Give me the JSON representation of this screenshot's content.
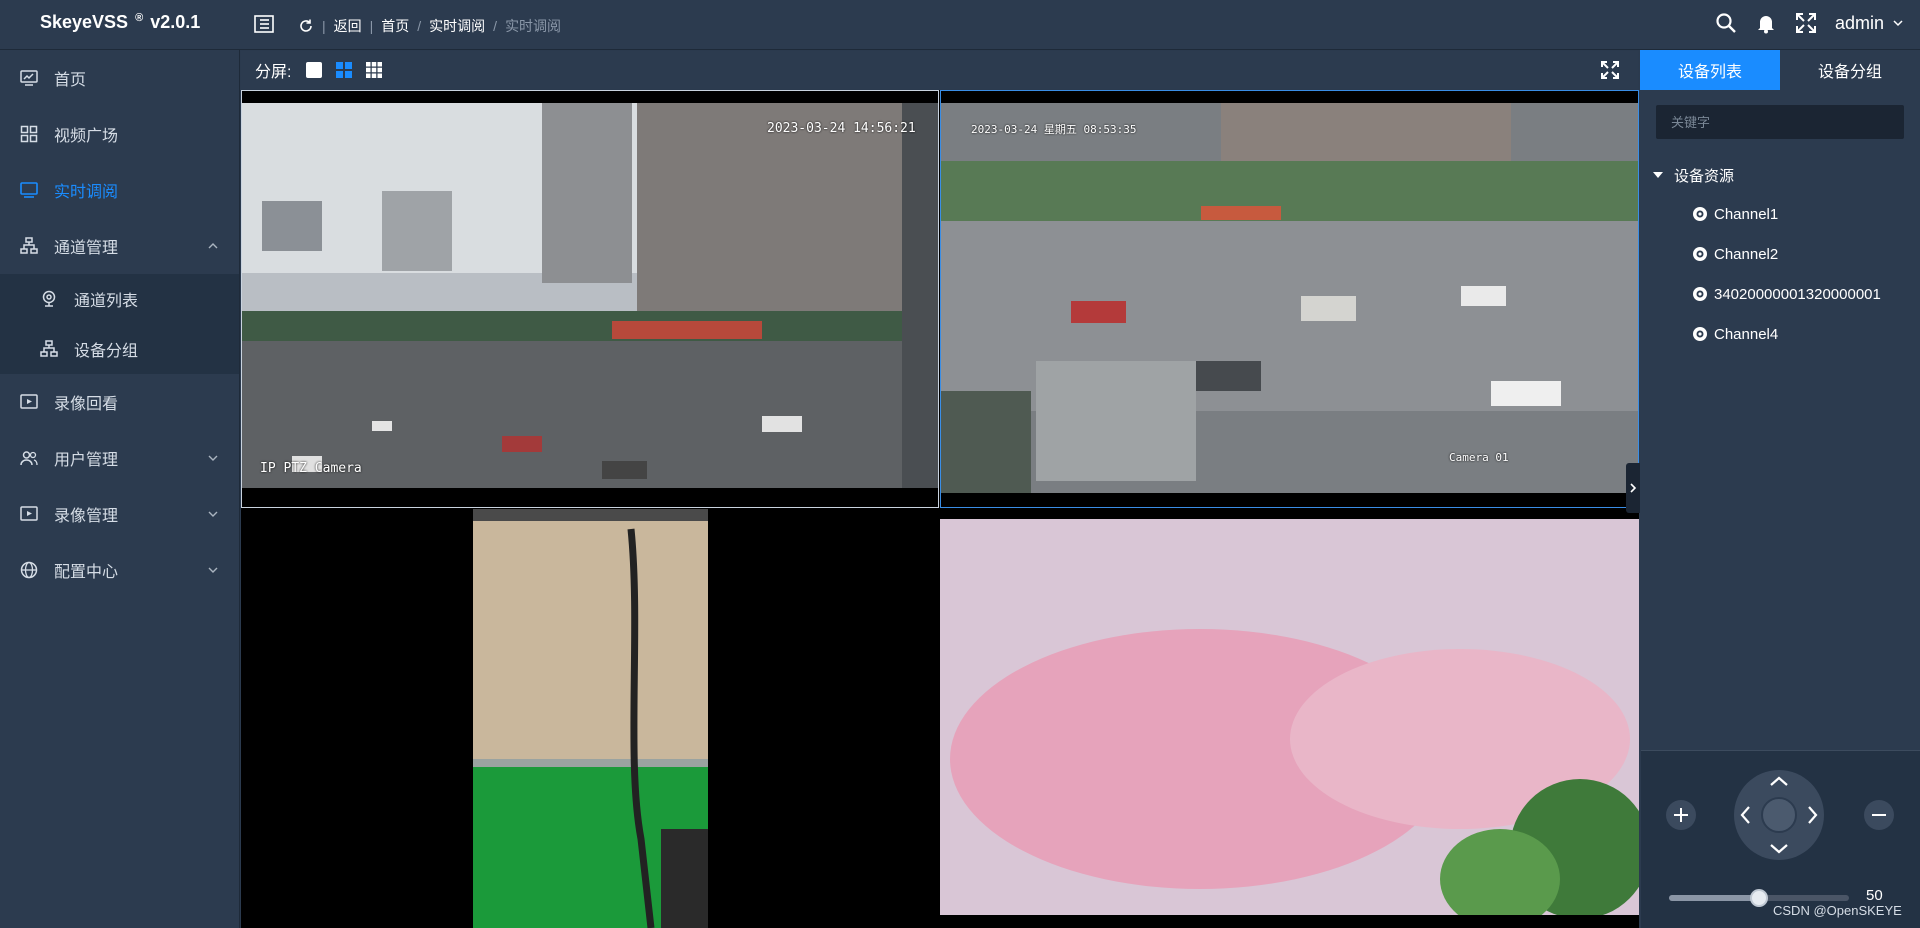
{
  "app": {
    "name": "SkeyeVSS",
    "reg": "®",
    "version": "v2.0.1"
  },
  "breadcrumb": {
    "back": "返回",
    "home": "首页",
    "parent": "实时调阅",
    "current": "实时调阅"
  },
  "header": {
    "user": "admin"
  },
  "sidebar": {
    "items": [
      {
        "label": "首页"
      },
      {
        "label": "视频广场"
      },
      {
        "label": "实时调阅"
      },
      {
        "label": "通道管理"
      },
      {
        "label": "录像回看"
      },
      {
        "label": "用户管理"
      },
      {
        "label": "录像管理"
      },
      {
        "label": "配置中心"
      }
    ],
    "submenu": [
      {
        "label": "通道列表"
      },
      {
        "label": "设备分组"
      }
    ]
  },
  "toolbar": {
    "split_label": "分屏:"
  },
  "videos": {
    "v1_time": "2023-03-24 14:56:21",
    "v1_cam": "IP PTZ Camera",
    "v2_time": "2023-03-24 星期五 08:53:35",
    "v2_cam": "Camera 01"
  },
  "rightpanel": {
    "tab_list": "设备列表",
    "tab_group": "设备分组",
    "search_placeholder": "关键字",
    "tree_root": "设备资源",
    "devices": [
      {
        "label": "Channel1"
      },
      {
        "label": "Channel2"
      },
      {
        "label": "34020000001320000001"
      },
      {
        "label": "Channel4"
      }
    ]
  },
  "ptz": {
    "speed": 50,
    "watermark": "CSDN @OpenSKEYE"
  },
  "colors": {
    "accent": "#1a8cff",
    "background": "#2c3b4f"
  }
}
